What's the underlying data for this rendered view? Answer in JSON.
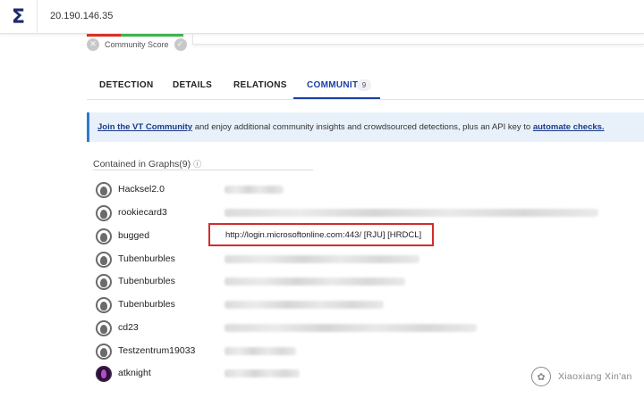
{
  "header": {
    "logo": "Σ",
    "search_value": "20.190.146.35"
  },
  "score": {
    "label": "Community Score",
    "x_icon": "✕",
    "check_icon": "✓"
  },
  "tabs": [
    {
      "label": "DETECTION"
    },
    {
      "label": "DETAILS"
    },
    {
      "label": "RELATIONS"
    },
    {
      "label": "COMMUNITY",
      "badge": "9"
    }
  ],
  "banner": {
    "link1": "Join the VT Community",
    "text": " and enjoy additional community insights and crowdsourced detections, plus an API key to ",
    "link2": "automate checks."
  },
  "section": {
    "title": "Contained in Graphs(9)",
    "icon": "ⓘ"
  },
  "graphs": [
    {
      "user": "Hacksel2.0",
      "title": ""
    },
    {
      "user": "rookiecard3",
      "title": ""
    },
    {
      "user": "bugged",
      "title": "http://login.microsoftonline.com:443/ [RJU] [HRDCL]"
    },
    {
      "user": "Tubenburbles",
      "title": ""
    },
    {
      "user": "Tubenburbles",
      "title": ""
    },
    {
      "user": "Tubenburbles",
      "title": ""
    },
    {
      "user": "cd23",
      "title": ""
    },
    {
      "user": "Testzentrum19033",
      "title": ""
    },
    {
      "user": "atknight",
      "title": ""
    }
  ],
  "watermark": {
    "text": "Xiaoxiang Xin'an"
  },
  "colors": {
    "accent": "#1a3fa6",
    "score_red": "#d93025",
    "score_green": "#3fb34f",
    "banner_bg": "#e8f1fa",
    "highlight": "#d22d2d"
  }
}
